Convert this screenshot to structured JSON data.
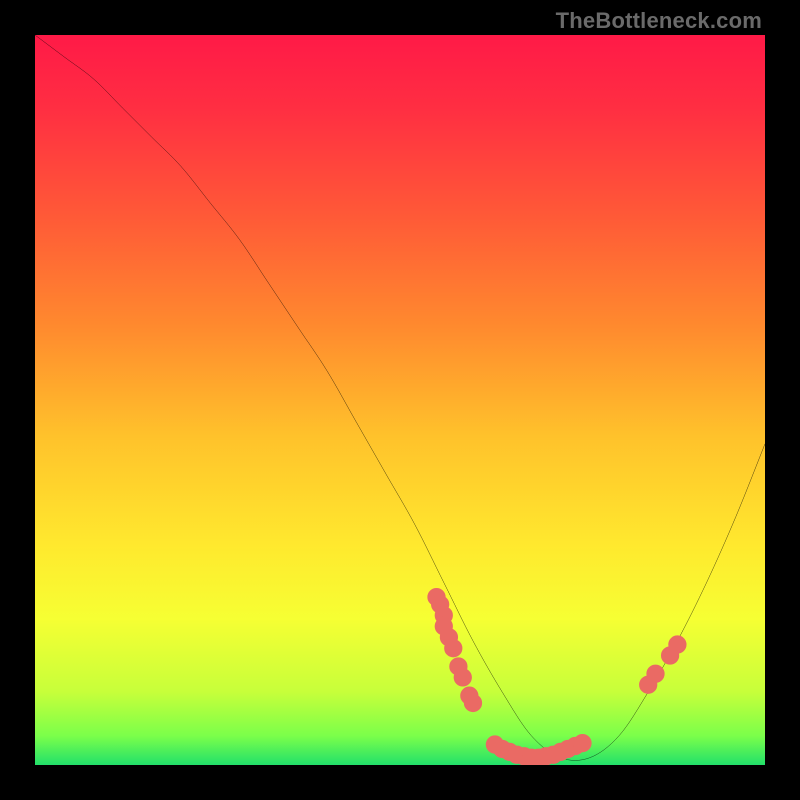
{
  "watermark": "TheBottleneck.com",
  "colors": {
    "background": "#000000",
    "curve": "#000000",
    "points": "#ea6a64",
    "gradient_stops": [
      {
        "offset": 0.0,
        "color": "#ff1a47"
      },
      {
        "offset": 0.1,
        "color": "#ff2e42"
      },
      {
        "offset": 0.25,
        "color": "#ff5a37"
      },
      {
        "offset": 0.4,
        "color": "#ff8a2e"
      },
      {
        "offset": 0.55,
        "color": "#ffc22b"
      },
      {
        "offset": 0.7,
        "color": "#ffe92e"
      },
      {
        "offset": 0.8,
        "color": "#f6ff33"
      },
      {
        "offset": 0.9,
        "color": "#c7ff3a"
      },
      {
        "offset": 0.96,
        "color": "#7bff4a"
      },
      {
        "offset": 1.0,
        "color": "#22e06a"
      }
    ]
  },
  "chart_data": {
    "type": "line",
    "title": "",
    "xlabel": "",
    "ylabel": "",
    "xlim": [
      0,
      100
    ],
    "ylim": [
      0,
      100
    ],
    "grid": false,
    "series": [
      {
        "name": "bottleneck-curve",
        "x": [
          0,
          4,
          8,
          12,
          16,
          20,
          24,
          28,
          32,
          36,
          40,
          44,
          48,
          52,
          56,
          60,
          64,
          68,
          72,
          76,
          80,
          84,
          88,
          92,
          96,
          100
        ],
        "y": [
          100,
          97,
          94,
          90,
          86,
          82,
          77,
          72,
          66,
          60,
          54,
          47,
          40,
          33,
          25,
          17,
          10,
          4,
          1,
          1,
          4,
          10,
          17,
          25,
          34,
          44
        ]
      }
    ],
    "scatter": [
      {
        "name": "cluster-left-slope",
        "points": [
          [
            55,
            23
          ],
          [
            55.5,
            22
          ],
          [
            56,
            20.5
          ],
          [
            56,
            19
          ],
          [
            56.7,
            17.5
          ],
          [
            57.3,
            16
          ],
          [
            58,
            13.5
          ],
          [
            58.6,
            12
          ],
          [
            59.5,
            9.5
          ],
          [
            60,
            8.5
          ]
        ]
      },
      {
        "name": "cluster-valley",
        "points": [
          [
            63,
            2.8
          ],
          [
            64,
            2.2
          ],
          [
            65,
            1.8
          ],
          [
            66,
            1.4
          ],
          [
            67,
            1.2
          ],
          [
            68,
            1.0
          ],
          [
            69,
            1.0
          ],
          [
            70,
            1.2
          ],
          [
            71,
            1.4
          ],
          [
            72,
            1.8
          ],
          [
            73,
            2.2
          ],
          [
            74,
            2.6
          ],
          [
            75,
            3.0
          ]
        ]
      },
      {
        "name": "cluster-right-slope",
        "points": [
          [
            84,
            11
          ],
          [
            85,
            12.5
          ],
          [
            87,
            15
          ],
          [
            88,
            16.5
          ]
        ]
      }
    ]
  }
}
